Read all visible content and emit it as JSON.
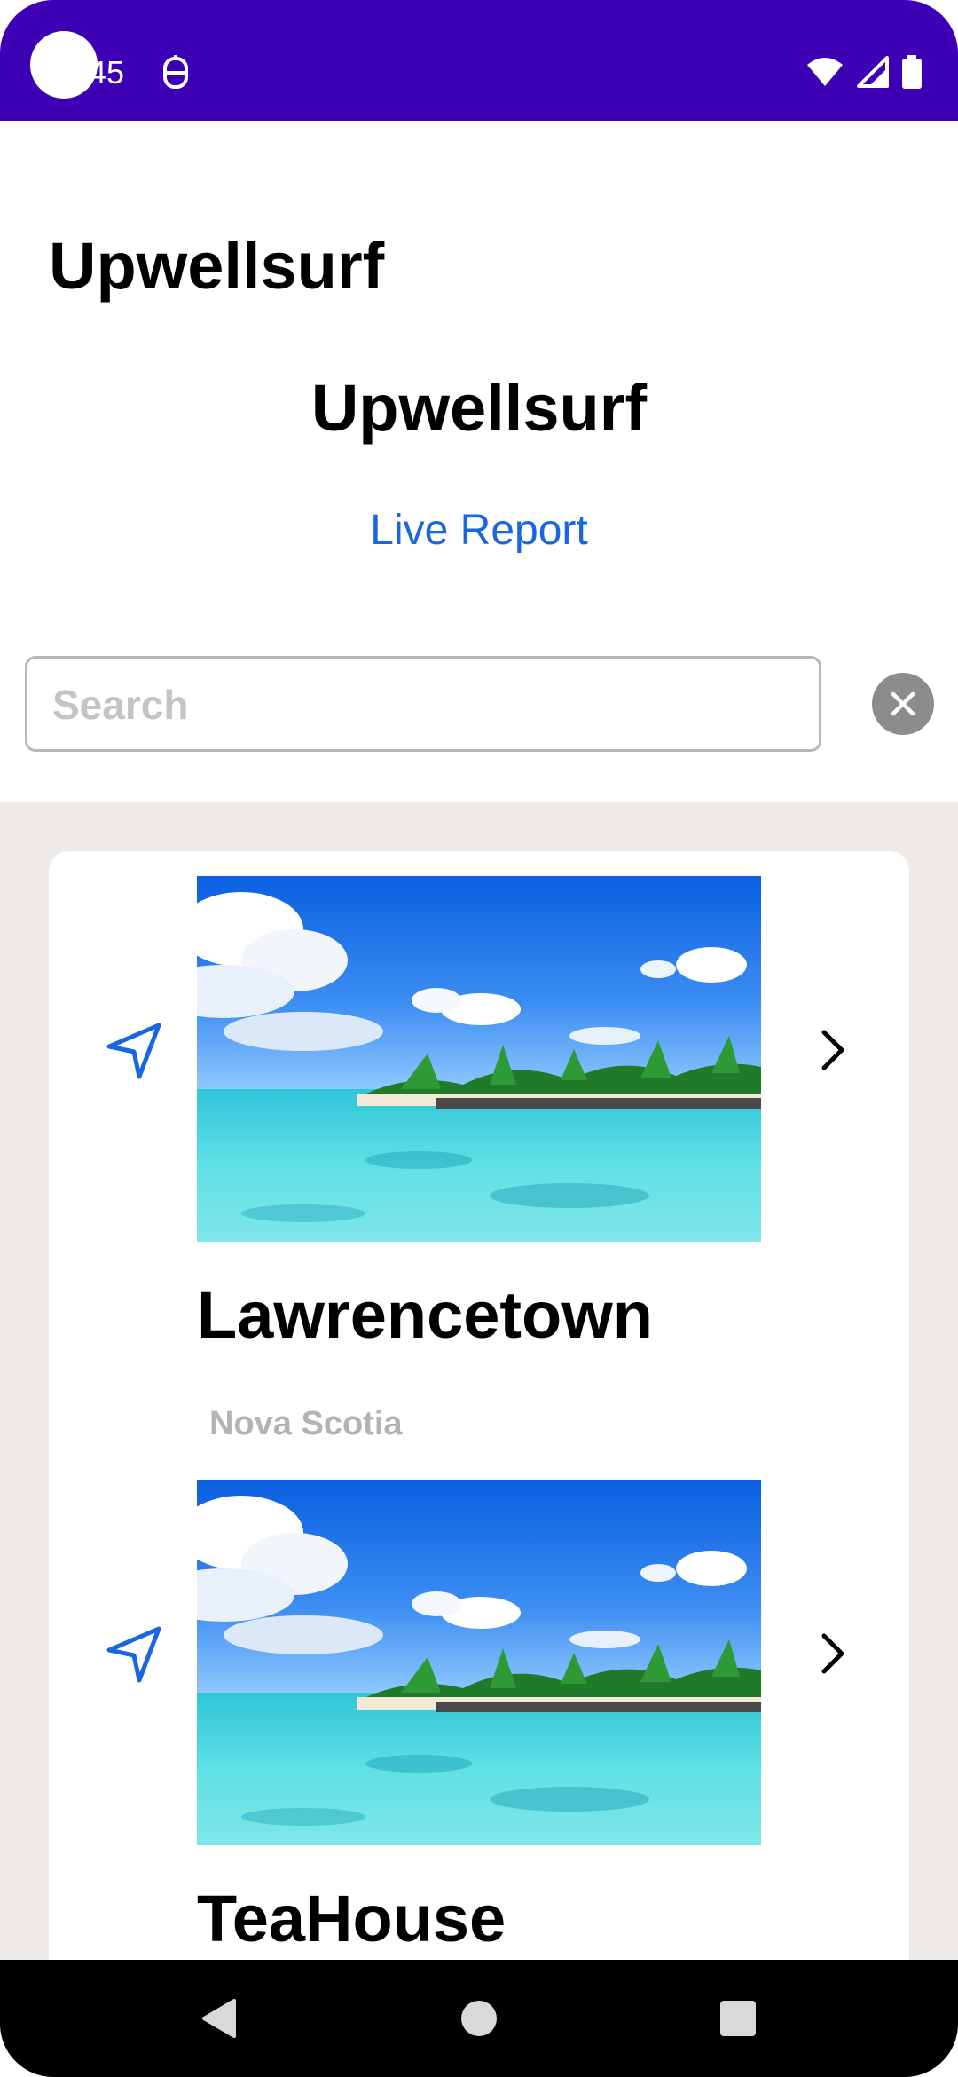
{
  "status_bar": {
    "time": "45",
    "icons": [
      "app-notification-icon",
      "wifi-icon",
      "cell-signal-icon",
      "battery-icon"
    ]
  },
  "header": {
    "app_title": "Upwellsurf",
    "page_title": "Upwellsurf",
    "live_report_link": "Live Report"
  },
  "search": {
    "value": "",
    "placeholder": "Search"
  },
  "spots": [
    {
      "name": "Lawrencetown",
      "region": "Nova Scotia"
    },
    {
      "name": "TeaHouse",
      "region": ""
    }
  ],
  "nav_bar": {
    "buttons": [
      "back",
      "home",
      "recents"
    ]
  },
  "colors": {
    "status_bar": "#3d00b5",
    "accent": "#1a66e0",
    "list_background": "#eeeae7",
    "muted_text": "#b3b3b3"
  }
}
